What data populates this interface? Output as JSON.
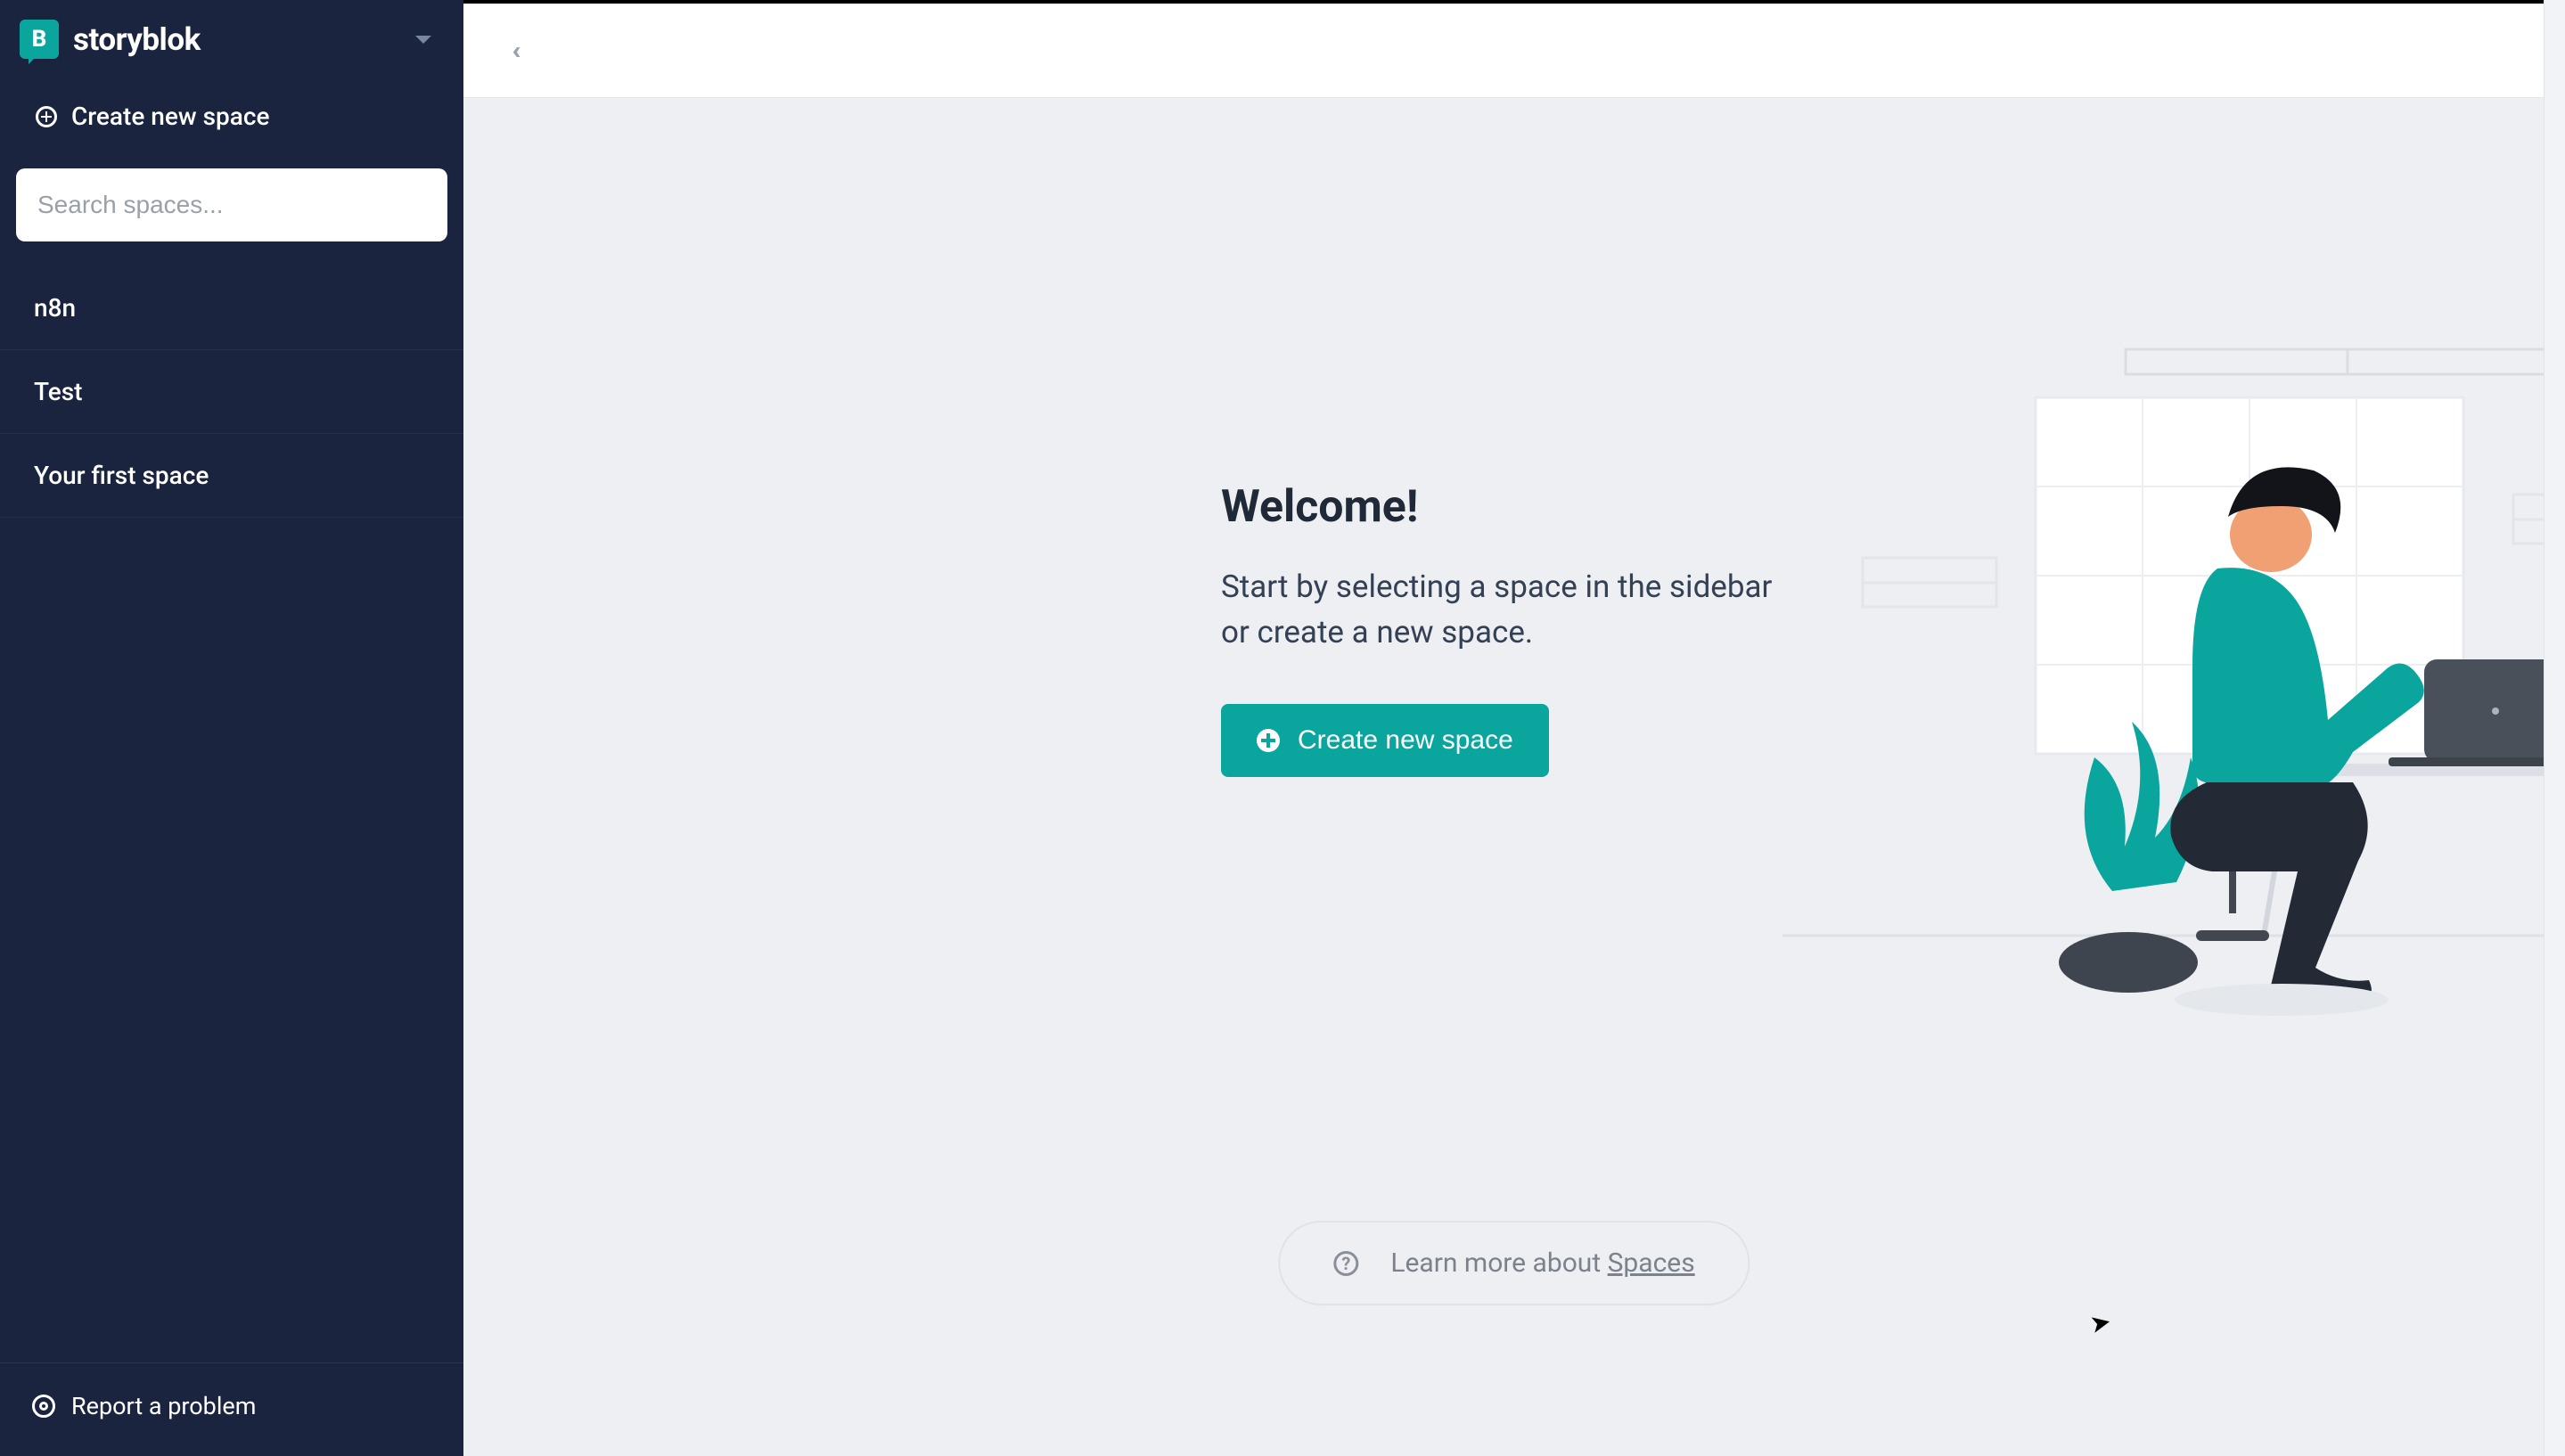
{
  "brand": {
    "name": "storyblok",
    "logo_letter": "B"
  },
  "sidebar": {
    "create_label": "Create new space",
    "search_placeholder": "Search spaces...",
    "spaces": [
      {
        "label": "n8n"
      },
      {
        "label": "Test"
      },
      {
        "label": "Your first space"
      }
    ],
    "report_label": "Report a problem"
  },
  "main": {
    "title": "Welcome!",
    "subtitle": "Start by selecting a space in the sidebar or create a new space.",
    "create_button": "Create new space",
    "learn_more_prefix": "Learn more about ",
    "learn_more_link": "Spaces"
  }
}
